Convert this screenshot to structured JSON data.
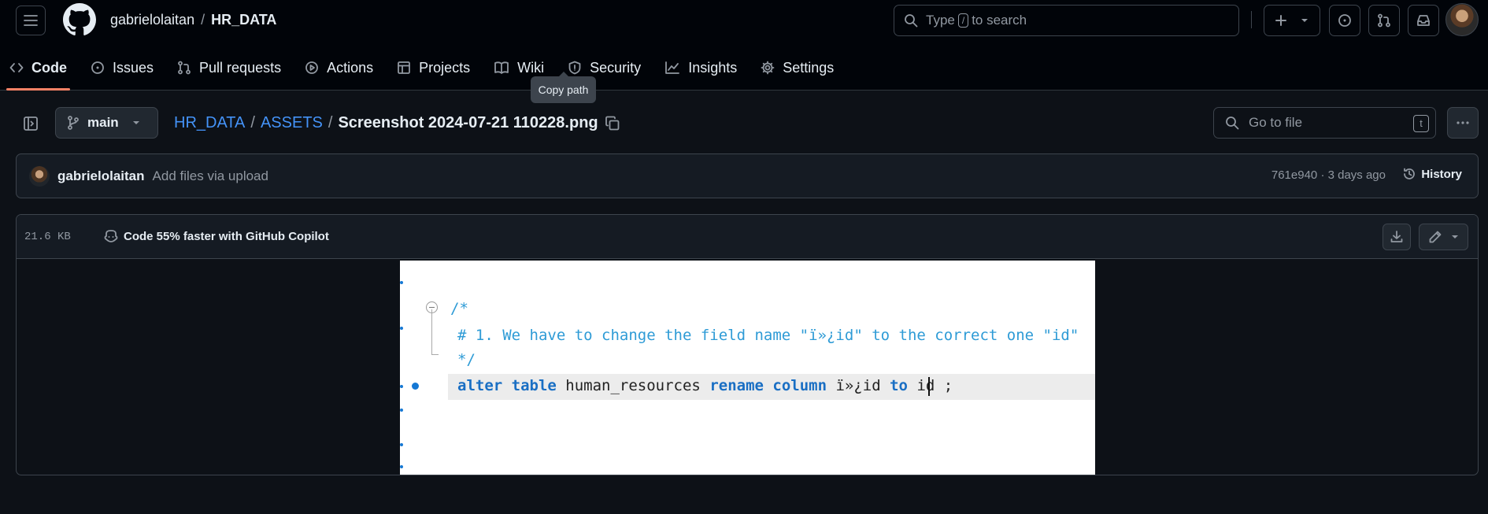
{
  "header": {
    "owner": "gabrielolaitan",
    "repo": "HR_DATA",
    "search_placeholder_pre": "Type",
    "search_key": "/",
    "search_placeholder_post": "to search"
  },
  "tabs": [
    {
      "label": "Code",
      "icon": "code-icon",
      "active": true
    },
    {
      "label": "Issues",
      "icon": "issue-icon"
    },
    {
      "label": "Pull requests",
      "icon": "pull-request-icon"
    },
    {
      "label": "Actions",
      "icon": "play-icon"
    },
    {
      "label": "Projects",
      "icon": "table-icon"
    },
    {
      "label": "Wiki",
      "icon": "book-icon"
    },
    {
      "label": "Security",
      "icon": "shield-icon"
    },
    {
      "label": "Insights",
      "icon": "graph-icon"
    },
    {
      "label": "Settings",
      "icon": "gear-icon"
    }
  ],
  "tooltip": "Copy path",
  "breadcrumb": {
    "branch": "main",
    "root": "HR_DATA",
    "folder": "ASSETS",
    "file": "Screenshot 2024-07-21 110228.png"
  },
  "goto_file": {
    "placeholder": "Go to file",
    "key": "t"
  },
  "commit": {
    "author": "gabrielolaitan",
    "message": "Add files via upload",
    "meta": "761e940 · 3 days ago",
    "history_label": "History"
  },
  "file": {
    "size": "21.6 KB",
    "copilot_text": "Code 55% faster with GitHub Copilot"
  },
  "image_code": {
    "line1": "/*",
    "line2": "# 1. We have to change the field name \"ï»¿id\" to the correct one \"id\"",
    "line3": "*/",
    "line4_kw1": "alter table",
    "line4_p1": " human_resources ",
    "line4_kw2": "rename column",
    "line4_p2": " ï»¿id ",
    "line4_kw3": "to",
    "line4_p3": " id ;"
  },
  "colors": {
    "accent_underline": "#f78166",
    "link": "#4493f8",
    "bg": "#0d1117"
  }
}
